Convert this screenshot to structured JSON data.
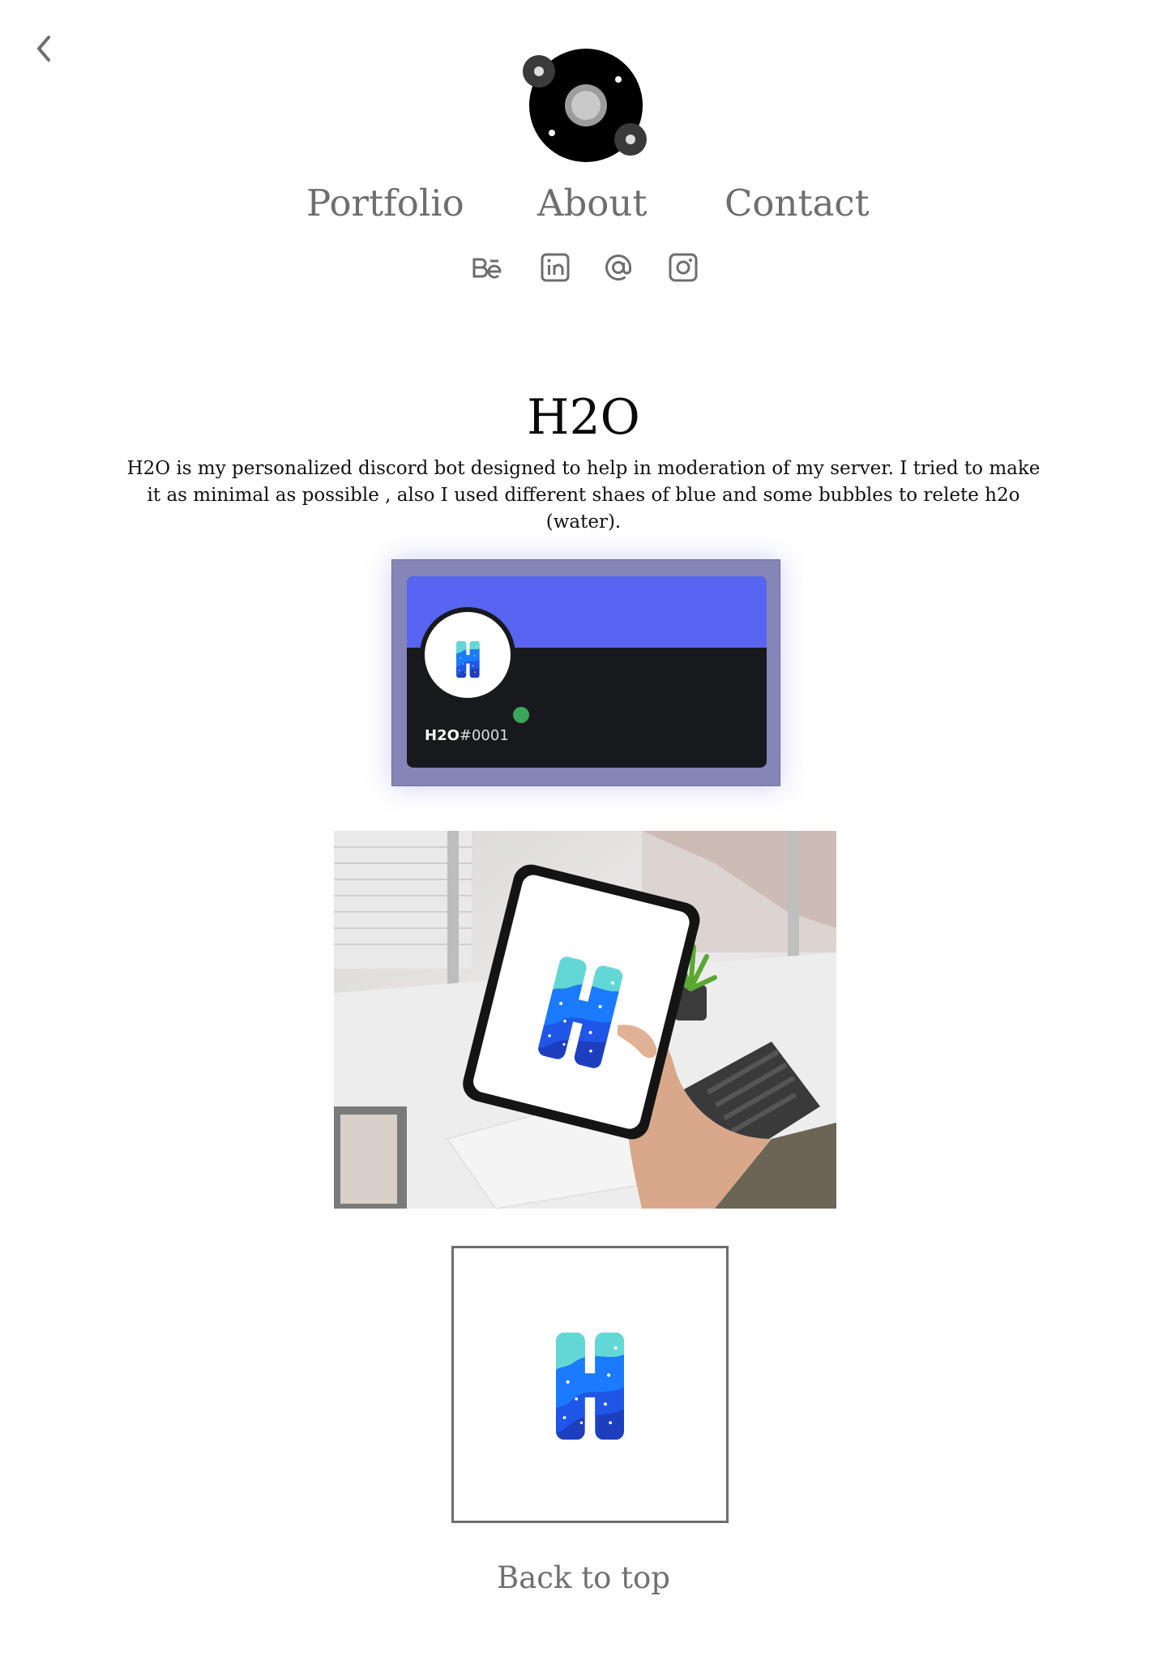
{
  "header": {
    "back_icon": "chevron-left-icon",
    "logo_icon": "orbit-logo-icon"
  },
  "nav": {
    "items": [
      {
        "label": "Portfolio"
      },
      {
        "label": "About"
      },
      {
        "label": "Contact"
      }
    ]
  },
  "social": {
    "behance_icon": "behance-icon",
    "linkedin_icon": "linkedin-icon",
    "email_icon": "at-sign-icon",
    "instagram_icon": "instagram-icon"
  },
  "project": {
    "title": "H2O",
    "description": "H2O is my personalized discord bot designed to help in moderation of my server. I tried to make it as minimal as possible , also I used different shaes of blue and some bubbles to relete h2o (water)."
  },
  "profile_card": {
    "username": "H2O",
    "discriminator": "#0001",
    "banner_color": "#5865f2",
    "status_color": "#3ba55c"
  },
  "footer": {
    "back_to_top": "Back to top"
  },
  "colors": {
    "nav_text": "#6e6e6e",
    "h_logo_top": "#5fd6d6",
    "h_logo_mid": "#1a7bff",
    "h_logo_bottom": "#1d3fbf"
  }
}
